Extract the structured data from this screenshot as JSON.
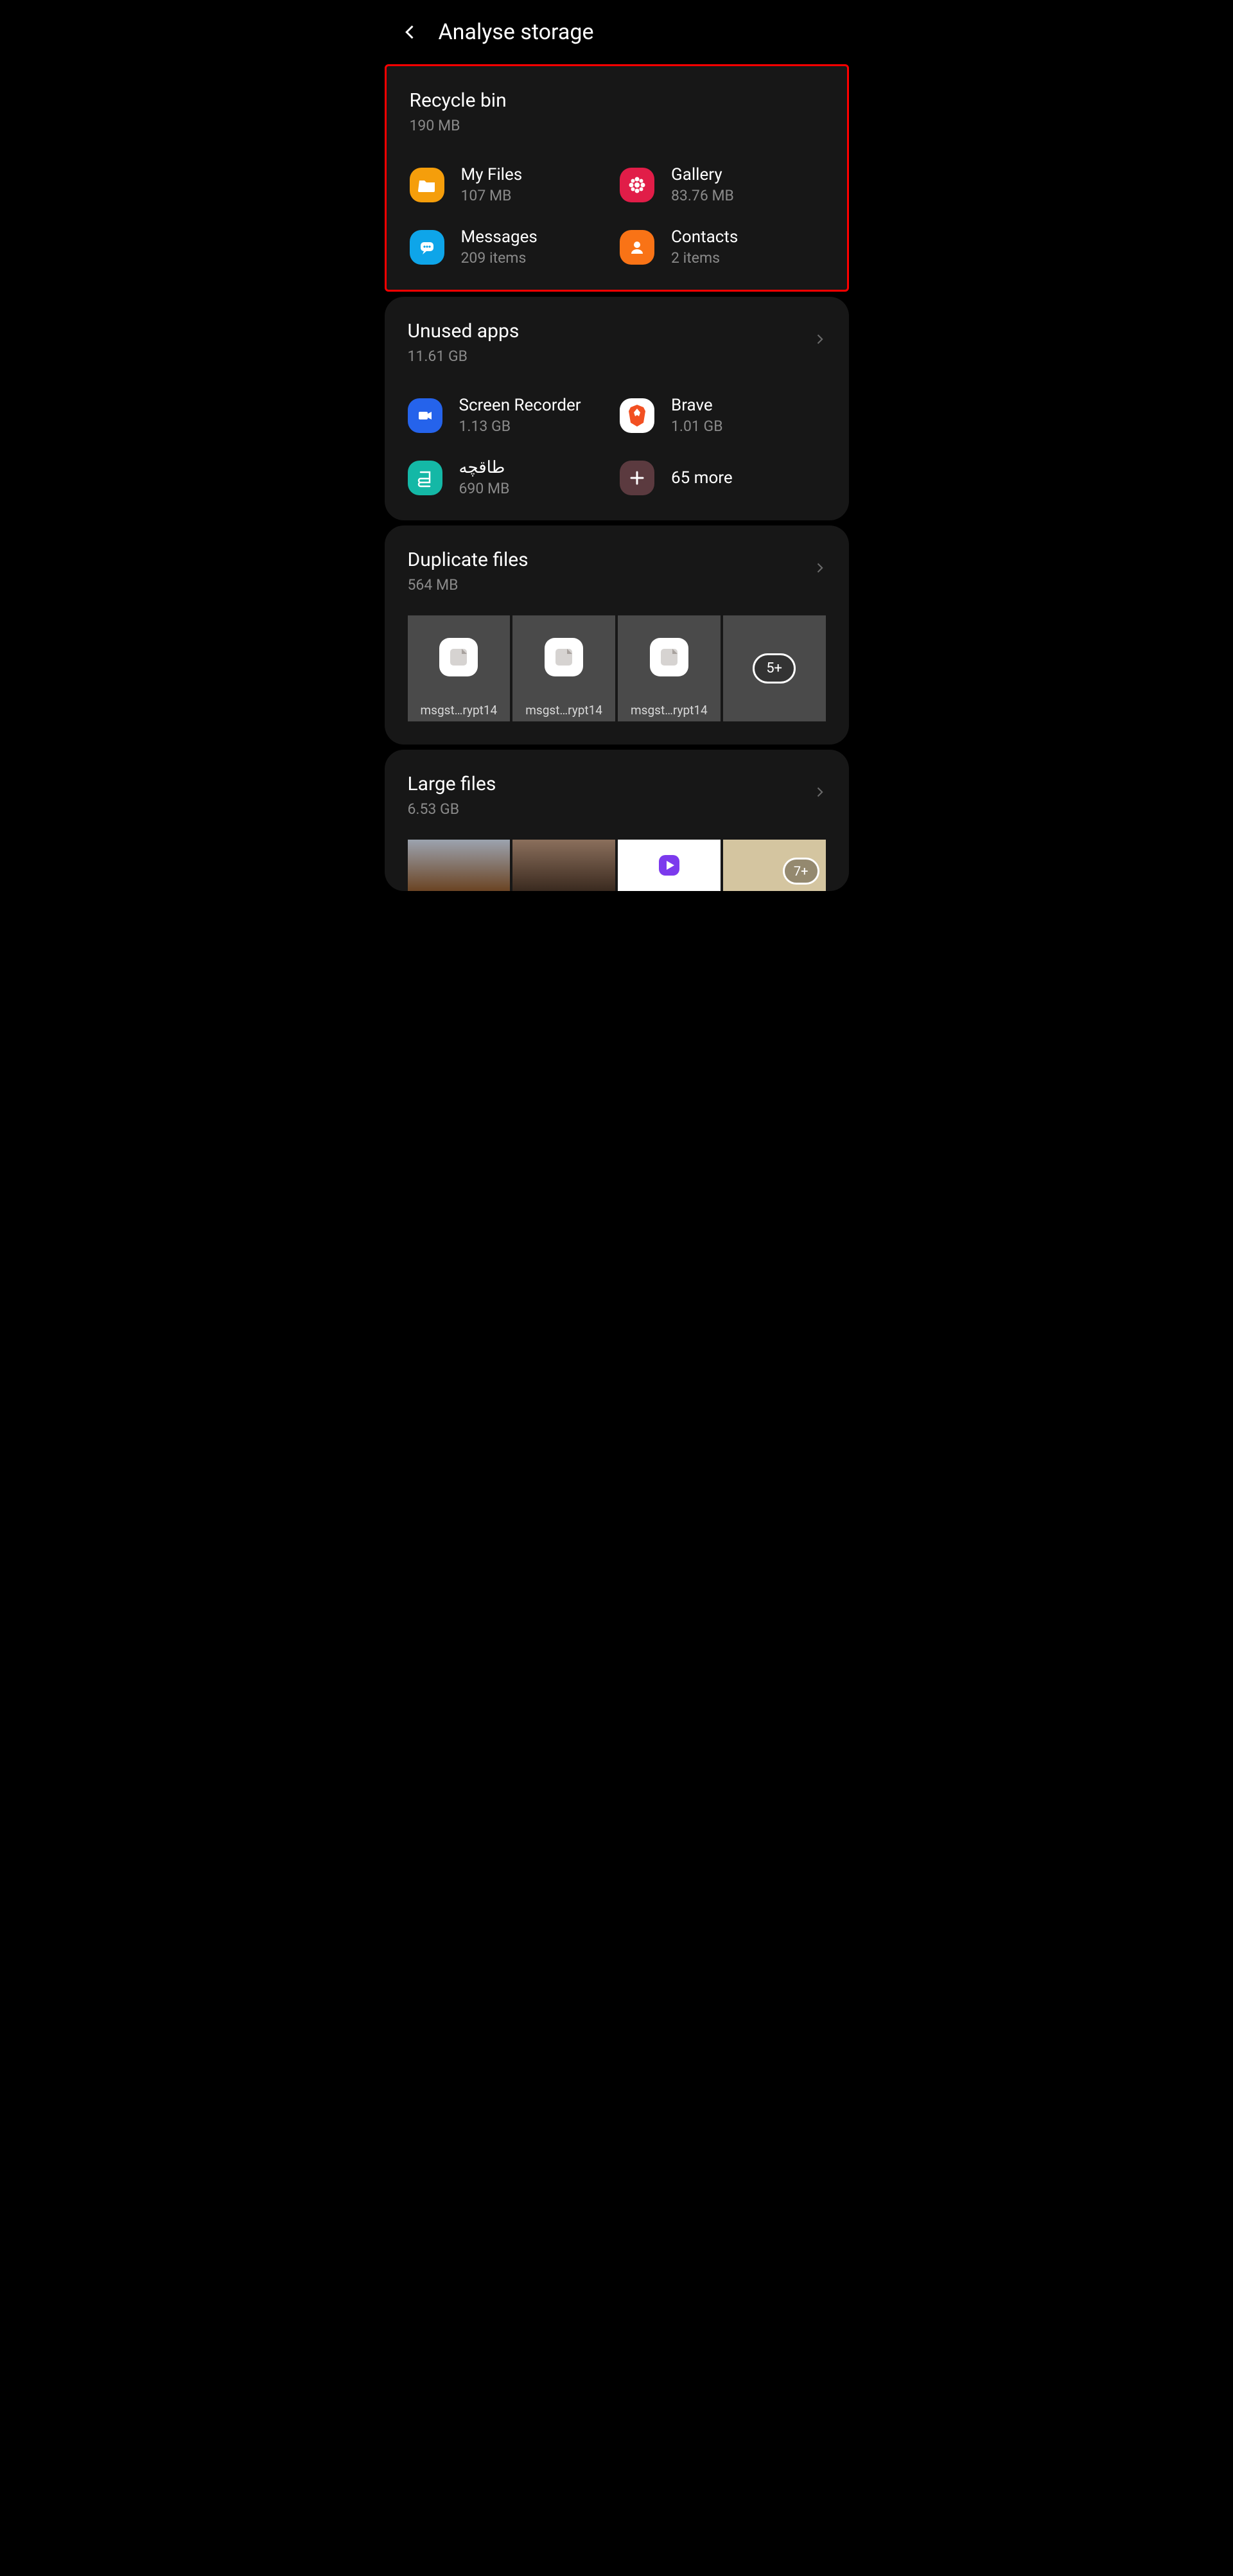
{
  "header": {
    "title": "Analyse storage"
  },
  "recycle": {
    "title": "Recycle bin",
    "size": "190 MB",
    "items": [
      {
        "title": "My Files",
        "sub": "107 MB"
      },
      {
        "title": "Gallery",
        "sub": "83.76 MB"
      },
      {
        "title": "Messages",
        "sub": "209 items"
      },
      {
        "title": "Contacts",
        "sub": "2 items"
      }
    ]
  },
  "unused": {
    "title": "Unused apps",
    "size": "11.61 GB",
    "items": [
      {
        "title": "Screen Recorder",
        "sub": "1.13 GB"
      },
      {
        "title": "Brave",
        "sub": "1.01 GB"
      },
      {
        "title": "طاقچه",
        "sub": "690 MB"
      },
      {
        "title": "65 more",
        "sub": ""
      }
    ]
  },
  "duplicate": {
    "title": "Duplicate files",
    "size": "564 MB",
    "thumbs": [
      {
        "label": "msgst…rypt14"
      },
      {
        "label": "msgst…rypt14"
      },
      {
        "label": "msgst…rypt14"
      }
    ],
    "more": "5+"
  },
  "large": {
    "title": "Large files",
    "size": "6.53 GB",
    "more": "7+"
  }
}
